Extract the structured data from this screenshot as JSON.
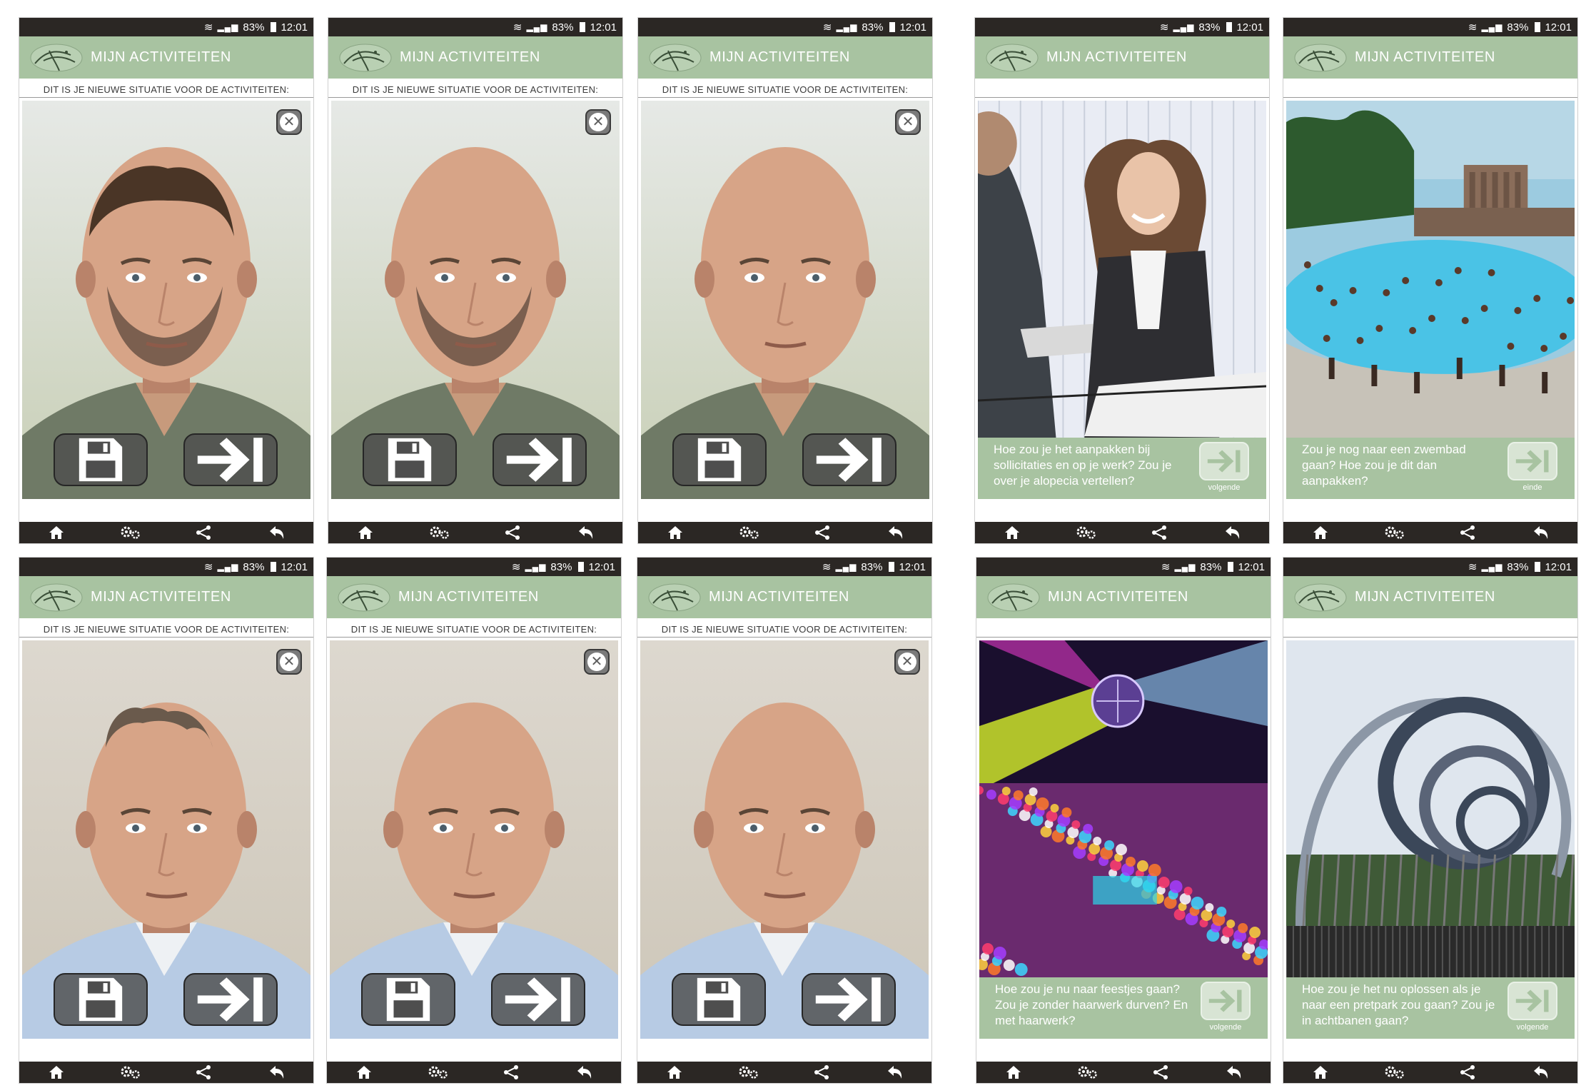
{
  "status": {
    "battery": "83%",
    "time": "12:01"
  },
  "app": {
    "title": "MIJN ACTIVITEITEN",
    "subtitle": "DIT IS JE NIEUWE SITUATIE VOOR DE ACTIVITEITEN:"
  },
  "colors": {
    "appbar": "#a8c3a1",
    "statusbar": "#2b2724",
    "button": "#4e4e4e"
  },
  "icons": {
    "close": "close-icon",
    "save": "floppy-disk-icon",
    "next": "arrow-to-bar-icon",
    "nav": [
      "home-icon",
      "gears-icon",
      "share-icon",
      "back-icon"
    ]
  },
  "phones_photo": [
    {
      "person": "man-a",
      "hair": "full"
    },
    {
      "person": "man-a",
      "hair": "bald-beard"
    },
    {
      "person": "man-a",
      "hair": "bald-shaved"
    },
    {
      "person": "man-b",
      "hair": "thinning"
    },
    {
      "person": "man-b",
      "hair": "bald"
    },
    {
      "person": "man-b",
      "hair": "bald"
    }
  ],
  "phones_scene": [
    {
      "scene": "office",
      "question": "Hoe zou je het aanpakken bij sollicitaties en op je werk? Zou je over je alopecia vertellen?",
      "button_label": "volgende"
    },
    {
      "scene": "pool",
      "question": "Zou je nog naar een zwembad gaan? Hoe zou je dit dan aanpakken?",
      "button_label": "einde"
    },
    {
      "scene": "party",
      "question": "Hoe zou je nu naar feestjes gaan? Zou je zonder haarwerk durven? En met haarwerk?",
      "button_label": "volgende"
    },
    {
      "scene": "coaster",
      "question": "Hoe zou je het nu oplossen als je naar een pretpark zou gaan? Zou je in achtbanen gaan?",
      "button_label": "volgende"
    }
  ]
}
